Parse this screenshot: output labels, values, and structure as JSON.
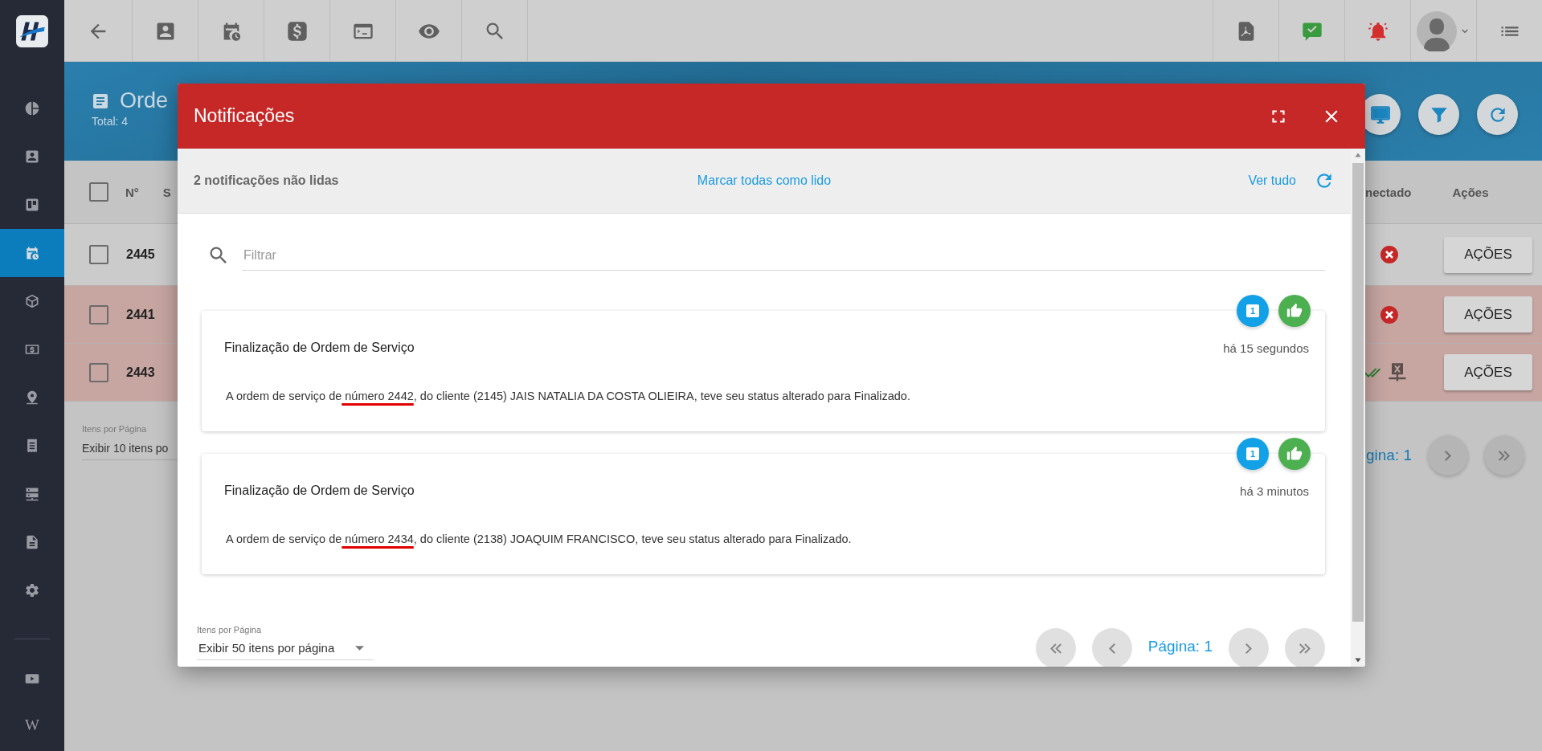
{
  "sidebar": {
    "items": [
      {
        "selected": false
      },
      {
        "selected": false
      },
      {
        "selected": false
      },
      {
        "selected": true
      },
      {
        "selected": false
      },
      {
        "selected": false
      },
      {
        "selected": false
      },
      {
        "selected": false
      },
      {
        "selected": false
      },
      {
        "selected": false
      },
      {
        "selected": false
      }
    ],
    "bottom_items": [
      {
        "selected": false
      },
      {
        "selected": false,
        "glyph": "W"
      }
    ]
  },
  "page": {
    "title": "Orde",
    "total": "Total: 4",
    "select_all_checked": false,
    "columns": [
      "N°",
      "S",
      "nectado",
      "Ações"
    ],
    "rows": [
      {
        "number": "2445",
        "checked": false,
        "highlighted": false,
        "kind": "error",
        "action": "AÇÕES"
      },
      {
        "number": "2441",
        "checked": false,
        "highlighted": true,
        "kind": "error",
        "action": "AÇÕES"
      },
      {
        "number": "2443",
        "checked": false,
        "highlighted": true,
        "kind": "done",
        "action": "AÇÕES"
      }
    ],
    "per_page_label": "Itens por Página",
    "per_page": "Exibir 10 itens po",
    "page_label": "gina: 1"
  },
  "dialog": {
    "title": "Notificações",
    "unread": "2 notificações não lidas",
    "mark_all": "Marcar todas como lido",
    "see_all": "Ver tudo",
    "filter_placeholder": "Filtrar",
    "notifications": [
      {
        "title": "Finalização de Ordem de Serviço",
        "time": "há 15 segundos",
        "badge": "1",
        "message": {
          "before": "A ordem de serviço de",
          "underlined": " número 2442",
          "after": ", do cliente (2145) JAIS NATALIA DA COSTA OLIEIRA, teve seu status alterado para Finalizado."
        }
      },
      {
        "title": "Finalização de Ordem de Serviço",
        "time": "há 3 minutos",
        "badge": "1",
        "message": {
          "before": "A ordem de serviço de",
          "underlined": " número 2434",
          "after": ", do cliente (2138) JOAQUIM FRANCISCO, teve seu status alterado para Finalizado."
        }
      }
    ],
    "per_page_label": "Itens por Página",
    "per_page": "Exibir 50 itens por página",
    "page_label": "Página: 1"
  }
}
